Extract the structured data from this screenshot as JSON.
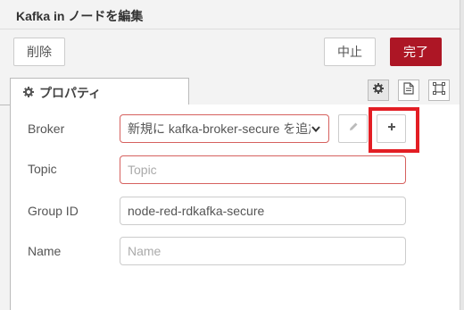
{
  "header": {
    "title": "Kafka in ノードを編集"
  },
  "toolbar": {
    "delete_label": "削除",
    "cancel_label": "中止",
    "done_label": "完了"
  },
  "tabs": {
    "properties_label": "プロパティ"
  },
  "form": {
    "broker": {
      "label": "Broker",
      "value": "新規に kafka-broker-secure を追加..."
    },
    "topic": {
      "label": "Topic",
      "placeholder": "Topic"
    },
    "group_id": {
      "label": "Group ID",
      "value": "node-red-rdkafka-secure"
    },
    "name": {
      "label": "Name",
      "placeholder": "Name"
    }
  },
  "colors": {
    "accent": "#ad1625",
    "invalid_border": "#d6615f",
    "highlight": "#e31e24"
  }
}
